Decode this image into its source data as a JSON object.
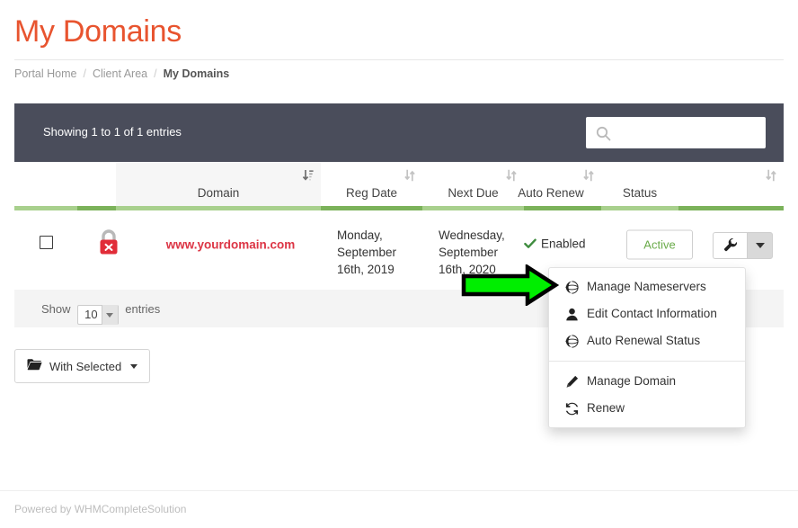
{
  "header": {
    "title": "My Domains",
    "title_color": "#e8542f"
  },
  "breadcrumb": {
    "items": [
      {
        "label": "Portal Home",
        "active": false
      },
      {
        "label": "Client Area",
        "active": false
      },
      {
        "label": "My Domains",
        "active": true
      }
    ],
    "separator": "/"
  },
  "toolbar": {
    "showing_text": "Showing 1 to 1 of 1 entries",
    "search_value": "",
    "search_placeholder": "",
    "search_icon": "search-icon",
    "background": "#4a4d5b"
  },
  "table": {
    "columns": [
      {
        "key": "select",
        "label": "",
        "sortable": false,
        "sorted": false
      },
      {
        "key": "lock",
        "label": "",
        "sortable": false,
        "sorted": false
      },
      {
        "key": "domain",
        "label": "Domain",
        "sortable": true,
        "sorted": true,
        "sort_dir": "asc"
      },
      {
        "key": "reg_date",
        "label": "Reg Date",
        "sortable": true,
        "sorted": false
      },
      {
        "key": "next_due",
        "label": "Next Due",
        "sortable": true,
        "sorted": false
      },
      {
        "key": "auto_renew",
        "label": "Auto Renew",
        "sortable": true,
        "sorted": false
      },
      {
        "key": "status",
        "label": "Status",
        "sortable": true,
        "sorted": false
      },
      {
        "key": "actions",
        "label": "",
        "sortable": true,
        "sorted": false
      }
    ],
    "rows": [
      {
        "checked": false,
        "lock_icon": "red-padlock-x-icon",
        "domain": "www.yourdomain.com",
        "reg_date": "Monday, September 16th, 2019",
        "next_due": "Wednesday, September 16th, 2020",
        "auto_renew": "Enabled",
        "auto_renew_icon": "check-icon",
        "status": "Active"
      }
    ],
    "actions": {
      "wrench_icon": "wrench-icon",
      "caret_icon": "chevron-down-icon"
    }
  },
  "table_footer": {
    "show_label": "Show",
    "page_length": "10",
    "entries_label": "entries"
  },
  "bulk": {
    "label": "With Selected",
    "icon": "folder-icon"
  },
  "dropdown": {
    "items": [
      {
        "label": "Manage Nameservers",
        "icon": "globe-icon"
      },
      {
        "label": "Edit Contact Information",
        "icon": "user-icon"
      },
      {
        "label": "Auto Renewal Status",
        "icon": "globe-icon"
      },
      {
        "divider": true
      },
      {
        "label": "Manage Domain",
        "icon": "pencil-icon"
      },
      {
        "label": "Renew",
        "icon": "refresh-icon"
      }
    ]
  },
  "annotation": {
    "type": "arrow-right",
    "fill": "#00ee00",
    "stroke": "#000000",
    "points_to": "Manage Nameservers"
  },
  "footer": {
    "powered_by": "Powered by WHMCompleteSolution"
  },
  "colors": {
    "accent": "#e8542f",
    "toolbar": "#4a4d5b",
    "green_light": "#a8d08d",
    "green_dark": "#7bb25a",
    "domain_red": "#dc3545",
    "status_green": "#6aab4a"
  }
}
